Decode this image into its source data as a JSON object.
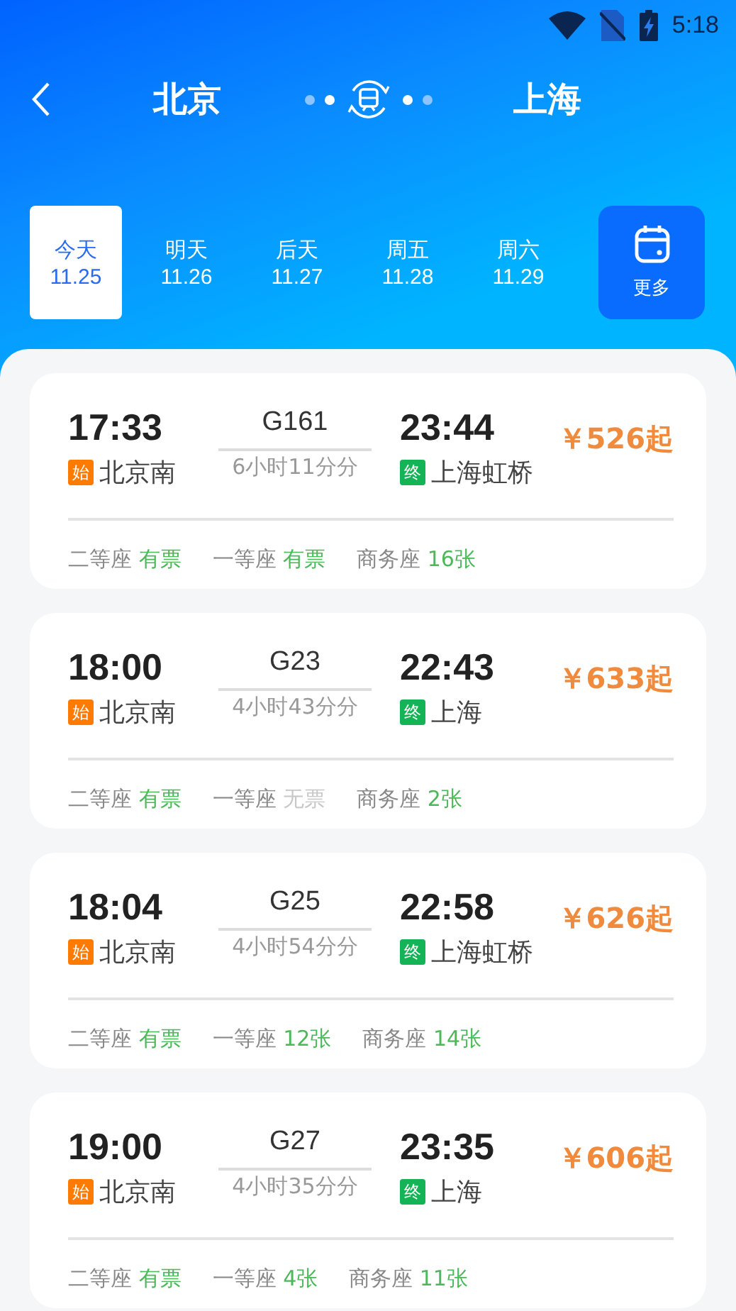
{
  "status_bar": {
    "time": "5:18"
  },
  "header": {
    "from": "北京",
    "to": "上海"
  },
  "dates": [
    {
      "day": "今天",
      "date": "11.25",
      "selected": true
    },
    {
      "day": "明天",
      "date": "11.26",
      "selected": false
    },
    {
      "day": "后天",
      "date": "11.27",
      "selected": false
    },
    {
      "day": "周五",
      "date": "11.28",
      "selected": false
    },
    {
      "day": "周六",
      "date": "11.29",
      "selected": false
    }
  ],
  "more_button": {
    "label": "更多"
  },
  "trains": [
    {
      "depart_time": "17:33",
      "train_no": "G161",
      "arrive_time": "23:44",
      "start_badge": "始",
      "from_station": "北京南",
      "duration": "6小时11分分",
      "end_badge": "终",
      "to_station": "上海虹桥",
      "price": "￥526起",
      "seats": [
        {
          "class": "二等座",
          "status": "有票",
          "available": true
        },
        {
          "class": "一等座",
          "status": "有票",
          "available": true
        },
        {
          "class": "商务座",
          "status": "16张",
          "available": true
        }
      ]
    },
    {
      "depart_time": "18:00",
      "train_no": "G23",
      "arrive_time": "22:43",
      "start_badge": "始",
      "from_station": "北京南",
      "duration": "4小时43分分",
      "end_badge": "终",
      "to_station": "上海",
      "price": "￥633起",
      "seats": [
        {
          "class": "二等座",
          "status": "有票",
          "available": true
        },
        {
          "class": "一等座",
          "status": "无票",
          "available": false
        },
        {
          "class": "商务座",
          "status": "2张",
          "available": true
        }
      ]
    },
    {
      "depart_time": "18:04",
      "train_no": "G25",
      "arrive_time": "22:58",
      "start_badge": "始",
      "from_station": "北京南",
      "duration": "4小时54分分",
      "end_badge": "终",
      "to_station": "上海虹桥",
      "price": "￥626起",
      "seats": [
        {
          "class": "二等座",
          "status": "有票",
          "available": true
        },
        {
          "class": "一等座",
          "status": "12张",
          "available": true
        },
        {
          "class": "商务座",
          "status": "14张",
          "available": true
        }
      ]
    },
    {
      "depart_time": "19:00",
      "train_no": "G27",
      "arrive_time": "23:35",
      "start_badge": "始",
      "from_station": "北京南",
      "duration": "4小时35分分",
      "end_badge": "终",
      "to_station": "上海",
      "price": "￥606起",
      "seats": [
        {
          "class": "二等座",
          "status": "有票",
          "available": true
        },
        {
          "class": "一等座",
          "status": "4张",
          "available": true
        },
        {
          "class": "商务座",
          "status": "11张",
          "available": true
        }
      ]
    }
  ]
}
